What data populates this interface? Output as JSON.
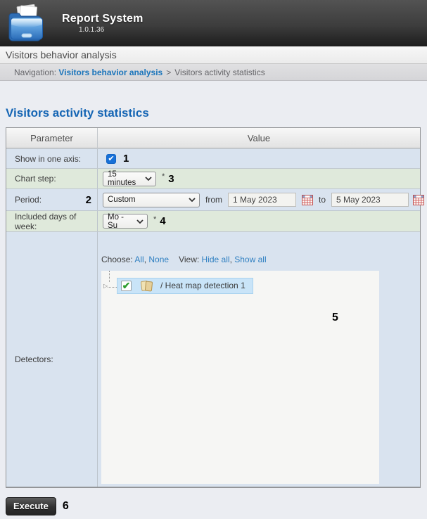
{
  "header": {
    "app_title": "Report System",
    "version": "1.0.1.36",
    "logo_icon": "report-folder-icon"
  },
  "title_bar": {
    "text": "Visitors behavior analysis"
  },
  "breadcrumb": {
    "label": "Navigation: ",
    "link": "Visitors behavior analysis",
    "separator": ">",
    "current": "Visitors activity statistics"
  },
  "page": {
    "title": "Visitors activity statistics"
  },
  "table": {
    "header": {
      "parameter": "Parameter",
      "value": "Value"
    },
    "show_in_one_axis": {
      "label": "Show in one axis:",
      "checked": true,
      "annotation": "1"
    },
    "chart_step": {
      "label": "Chart step:",
      "selected": "15 minutes",
      "required_mark": "*",
      "annotation": "3"
    },
    "period": {
      "label": "Period:",
      "annotation": "2",
      "selected": "Custom",
      "from_label": "from",
      "from_value": "1 May 2023",
      "to_label": "to",
      "to_value": "5 May 2023"
    },
    "days_of_week": {
      "label": "Included days of week:",
      "selected": "Mo - Su",
      "required_mark": "*",
      "annotation": "4"
    },
    "detectors": {
      "label": "Detectors:",
      "choose_label": "Choose: ",
      "link_all": "All",
      "link_none": "None",
      "view_label": "View: ",
      "link_hide_all": "Hide all",
      "link_show_all": "Show all",
      "comma": ", ",
      "tree_item_label": "/ Heat map detection 1",
      "annotation": "5"
    }
  },
  "footer": {
    "execute_label": "Execute",
    "annotation": "6"
  },
  "icons": {
    "check_glyph": "✔",
    "expander_glyph": "▷",
    "chevron_down": "chevron-down-icon",
    "calendar": "calendar-icon",
    "folder": "folder-icon"
  },
  "colors": {
    "accent_title": "#1565b4",
    "breadcrumb_link": "#1b75bb",
    "content_link": "#2e7fc1",
    "row_blue": "#d9e3ef",
    "row_green": "#dfe9db",
    "checkbox_blue": "#1871d8",
    "check_green": "#2f9e2f",
    "tree_highlight": "#c9e4f8",
    "header_dark": "#3d3d3d"
  }
}
